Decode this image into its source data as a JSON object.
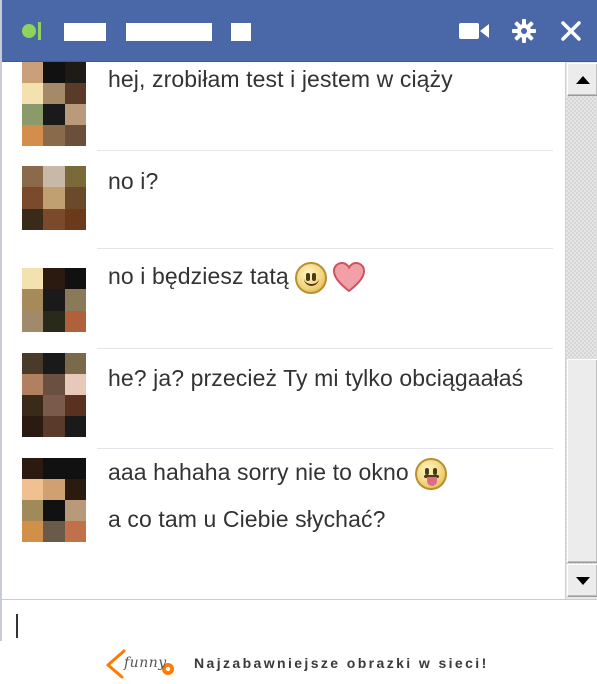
{
  "titlebar": {
    "status_color": "#8ed35c",
    "bar_color": "#4a68a8",
    "icons": [
      "video-camera-icon",
      "gear-icon",
      "close-icon"
    ]
  },
  "messages": [
    {
      "avatar_colors": [
        "#c9a07a",
        "#111111",
        "#1e1a16",
        "#f3e1b0",
        "#a58a6a",
        "#5a3b2a",
        "#8a9a6a",
        "#1a1a1a",
        "#b99a7a",
        "#d48e4c",
        "#8a6a4a",
        "#6b4f3a"
      ],
      "lines": [
        "hej, zrobiłam test i jestem w ciąży"
      ]
    },
    {
      "avatar_colors": [
        "#8a6a4a",
        "#c8b8a8",
        "#7a6a3a",
        "#7a4a2a",
        "#c0a070",
        "#6a4a2a",
        "#3a2a1a",
        "#7a4a2a",
        "#6a3a1a"
      ],
      "lines": [
        "no i?"
      ]
    },
    {
      "avatar_colors": [
        "#f3e1b0",
        "#2a1a10",
        "#111111",
        "#a68a5a",
        "#1a1a1a",
        "#8a7a5a",
        "#a08a6a",
        "#2a2a1a",
        "#b0603a",
        "#7a6a5a",
        "#4a3a2a",
        "#c05a2a"
      ],
      "lines": [
        "no i będziesz tatą"
      ],
      "emojis": [
        "smile-emoji",
        "heart-emoji"
      ]
    },
    {
      "avatar_colors": [
        "#4a3a2a",
        "#1a1a1a",
        "#7a6a4a",
        "#b08060",
        "#6a5040",
        "#e8c8b8",
        "#3a2a1a",
        "#7a5a4a",
        "#5a3020",
        "#2a1a10",
        "#5a3a2a",
        "#1a1a1a"
      ],
      "lines": [
        "he? ja? przecież Ty mi tylko obciągaałaś"
      ]
    },
    {
      "avatar_colors": [
        "#2a1a10",
        "#111111",
        "#111111",
        "#f0c090",
        "#d0a070",
        "#2a1a10",
        "#a08a5a",
        "#111111",
        "#b89a7a",
        "#d0904a",
        "#6a5a4a",
        "#c0704a"
      ],
      "lines": [
        "aaa hahaha sorry nie to okno",
        "a co tam u Ciebie słychać?"
      ],
      "emojis": [
        "tongue-emoji"
      ]
    }
  ],
  "input": {
    "value": ""
  },
  "footer": {
    "logo_text": "funny",
    "tagline": "Najzabawniejsze obrazki w sieci!"
  }
}
